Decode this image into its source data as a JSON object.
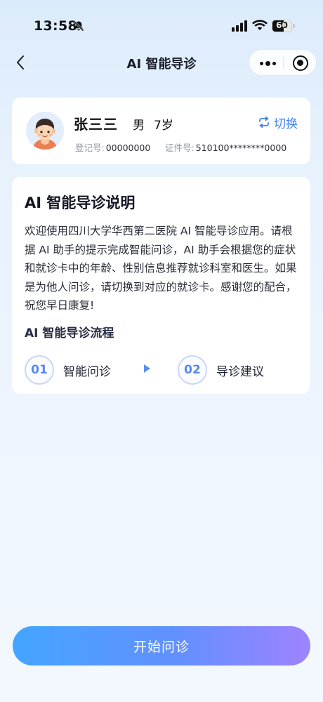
{
  "status_bar": {
    "time": "13:58",
    "battery_level": "60",
    "battery_fraction": 0.6
  },
  "nav": {
    "title": "AI 智能导诊"
  },
  "patient": {
    "name": "张三三",
    "gender": "男",
    "age": "7岁",
    "switch_label": "切换",
    "reg_label": "登记号:",
    "reg_value": "00000000",
    "id_label": "证件号:",
    "id_value": "510100********0000"
  },
  "intro": {
    "title": "AI 智能导诊说明",
    "text": "欢迎使用四川大学华西第二医院 AI 智能导诊应用。请根据 AI 助手的提示完成智能问诊，AI 助手会根据您的症状和就诊卡中的年龄、性别信息推荐就诊科室和医生。如果是为他人问诊，请切换到对应的就诊卡。感谢您的配合，祝您早日康复!",
    "flow_title": "AI 智能导诊流程",
    "steps": [
      {
        "num": "01",
        "label": "智能问诊"
      },
      {
        "num": "02",
        "label": "导诊建议"
      }
    ]
  },
  "actions": {
    "start_label": "开始问诊"
  },
  "colors": {
    "accent": "#3e7ff3",
    "button_gradient_start": "#3aa1ff",
    "button_gradient_end": "#9a7dff"
  },
  "icons": [
    "bell-muted-icon",
    "signal-icon",
    "wifi-icon",
    "battery-icon",
    "back-icon",
    "more-icon",
    "record-icon",
    "avatar-boy-icon",
    "switch-icon",
    "arrow-right-icon"
  ]
}
